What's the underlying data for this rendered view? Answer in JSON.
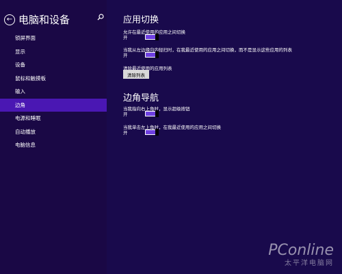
{
  "sidebar": {
    "title": "电脑和设备",
    "back_glyph": "←",
    "items": [
      {
        "label": "锁屏界面"
      },
      {
        "label": "显示"
      },
      {
        "label": "设备"
      },
      {
        "label": "鼠标和触摸板"
      },
      {
        "label": "输入"
      },
      {
        "label": "边角"
      },
      {
        "label": "电源和睡眠"
      },
      {
        "label": "自动播放"
      },
      {
        "label": "电脑信息"
      }
    ],
    "active_index": 5
  },
  "app_switching": {
    "title": "应用切换",
    "setting1": {
      "label": "允许在最近使用的应用之间切换",
      "state": "开"
    },
    "setting2": {
      "label": "当我从左边缘向内轻扫时，在我最近使用的应用之间切换，而不是显示这些应用的列表",
      "state": "开"
    },
    "clear_label": "清除最近使用的应用列表",
    "clear_button": "清除列表"
  },
  "corner_navigation": {
    "title": "边角导航",
    "setting1": {
      "label": "当我指向右上角时，显示超级按钮",
      "state": "开"
    },
    "setting2": {
      "label": "当我单击左上角时，在我最近使用的应用之间切换",
      "state": "开"
    }
  },
  "watermark": {
    "brand": "PConline",
    "sub": "太平洋电脑网"
  },
  "colors": {
    "accent": "#4a17b3",
    "toggle_on": "#6d3fe0",
    "sidebar_bg": "#1a0845",
    "main_bg": "#190a4c"
  }
}
